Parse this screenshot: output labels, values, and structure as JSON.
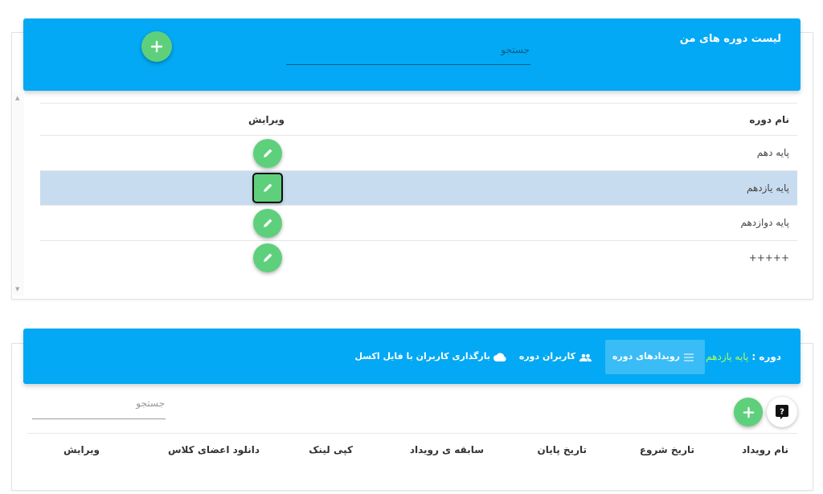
{
  "courses_panel": {
    "title": "لیست دوره های من",
    "search_placeholder": "جستجو",
    "columns": {
      "name": "نام دوره",
      "edit": "ویرایش"
    },
    "rows": [
      {
        "name": "پایه دهم",
        "selected": false
      },
      {
        "name": "پایه یازدهم",
        "selected": true
      },
      {
        "name": "پایه دوازدهم",
        "selected": false
      },
      {
        "name": "+++++",
        "selected": false
      }
    ]
  },
  "events_panel": {
    "course_label": "دوره :",
    "course_name": "پایه یازدهم",
    "tabs": [
      {
        "label": "رویدادهای دوره",
        "icon": "list-icon",
        "active": true
      },
      {
        "label": "کاربران دوره",
        "icon": "users-icon",
        "active": false
      },
      {
        "label": "بارگذاری کاربران با فایل اکسل",
        "icon": "cloud-icon",
        "active": false
      }
    ],
    "search_placeholder": "جستجو",
    "columns": [
      "نام رویداد",
      "تاریخ شروع",
      "تاریخ پایان",
      "سابقه ی رویداد",
      "کپی لینک",
      "دانلود اعضای کلاس",
      "ویرایش"
    ]
  },
  "colors": {
    "header": "#03a9f4",
    "fab": "#5ed07c",
    "selected_row": "#c8dcef",
    "course_highlight": "#b2ff59"
  }
}
